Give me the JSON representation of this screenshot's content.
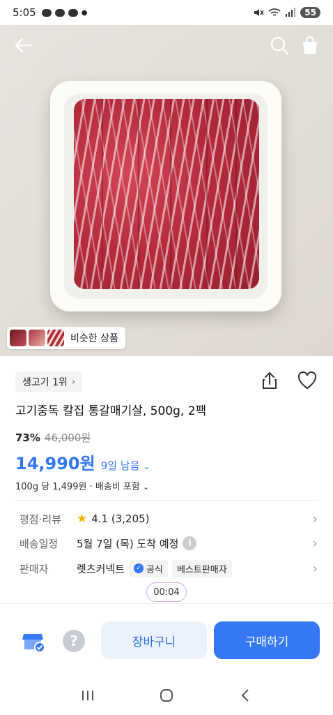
{
  "status_bar": {
    "time": "5:05",
    "battery": "55"
  },
  "hero": {
    "similar_label": "비슷한 상품"
  },
  "product": {
    "rank_chip": "생고기 1위",
    "title": "고기중독 칼집 통갈매기살, 500g, 2팩",
    "discount": "73%",
    "original_price": "46,000원",
    "price": "14,990원",
    "days_left": "9일 남음",
    "unit_info": "100g 당 1,499원 · 배송비 포함"
  },
  "info": {
    "rating_label": "평점·리뷰",
    "rating_value": "4.1 (3,205)",
    "delivery_label": "배송일정",
    "delivery_value": "5월 7일 (목) 도착 예정",
    "seller_label": "판매자",
    "seller_name": "렛츠커넥트",
    "badge_official": "공식",
    "badge_best": "베스트판매자"
  },
  "timer": "00:04",
  "actions": {
    "cart": "장바구니",
    "buy": "구매하기"
  },
  "colors": {
    "accent": "#3478f6",
    "accent_light": "#eaf2fe"
  }
}
